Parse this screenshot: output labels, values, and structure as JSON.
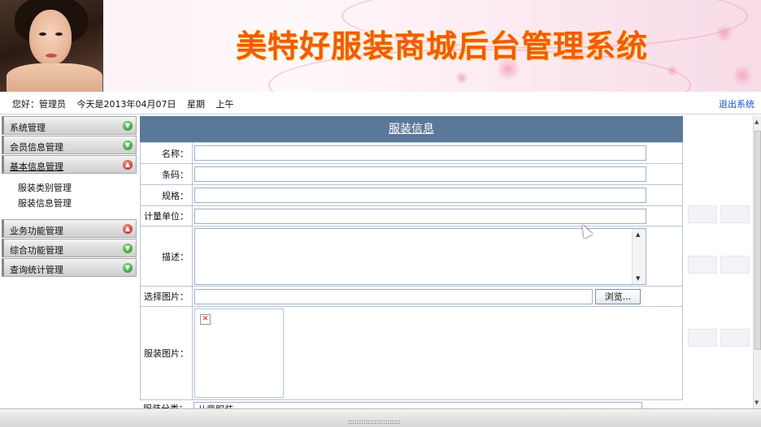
{
  "header": {
    "system_title": "美特好服装商城后台管理系统"
  },
  "infobar": {
    "greeting": "您好：管理员",
    "date_text": "今天是2013年04月07日",
    "weekday": "星期",
    "period": "上午",
    "logout_label": "退出系统"
  },
  "sidebar": {
    "items": [
      {
        "label": "系统管理",
        "state": "collapsed",
        "toggle_color": "green"
      },
      {
        "label": "会员信息管理",
        "state": "collapsed",
        "toggle_color": "green"
      },
      {
        "label": "基本信息管理",
        "state": "expanded",
        "toggle_color": "red",
        "children": [
          "服装类别管理",
          "服装信息管理"
        ]
      },
      {
        "label": "业务功能管理",
        "state": "collapsed",
        "toggle_color": "red"
      },
      {
        "label": "综合功能管理",
        "state": "collapsed",
        "toggle_color": "green"
      },
      {
        "label": "查询统计管理",
        "state": "collapsed",
        "toggle_color": "green"
      }
    ]
  },
  "form": {
    "title": "服装信息",
    "fields": {
      "name_label": "名称：",
      "barcode_label": "条码：",
      "spec_label": "规格：",
      "unit_label": "计量单位：",
      "desc_label": "描述：",
      "choose_image_label": "选择图片：",
      "browse_label": "浏览...",
      "image_label": "服装图片：",
      "category_label": "服装分类：",
      "category_value": "儿童服装"
    }
  },
  "colors": {
    "form_header_bg": "#5a7898",
    "title_orange": "#f05a10",
    "logout_link": "#1a4fc9"
  },
  "icons": {
    "expand": "circle-arrow-down-icon",
    "collapse": "circle-arrow-up-icon",
    "broken_image": "broken-image-icon"
  }
}
